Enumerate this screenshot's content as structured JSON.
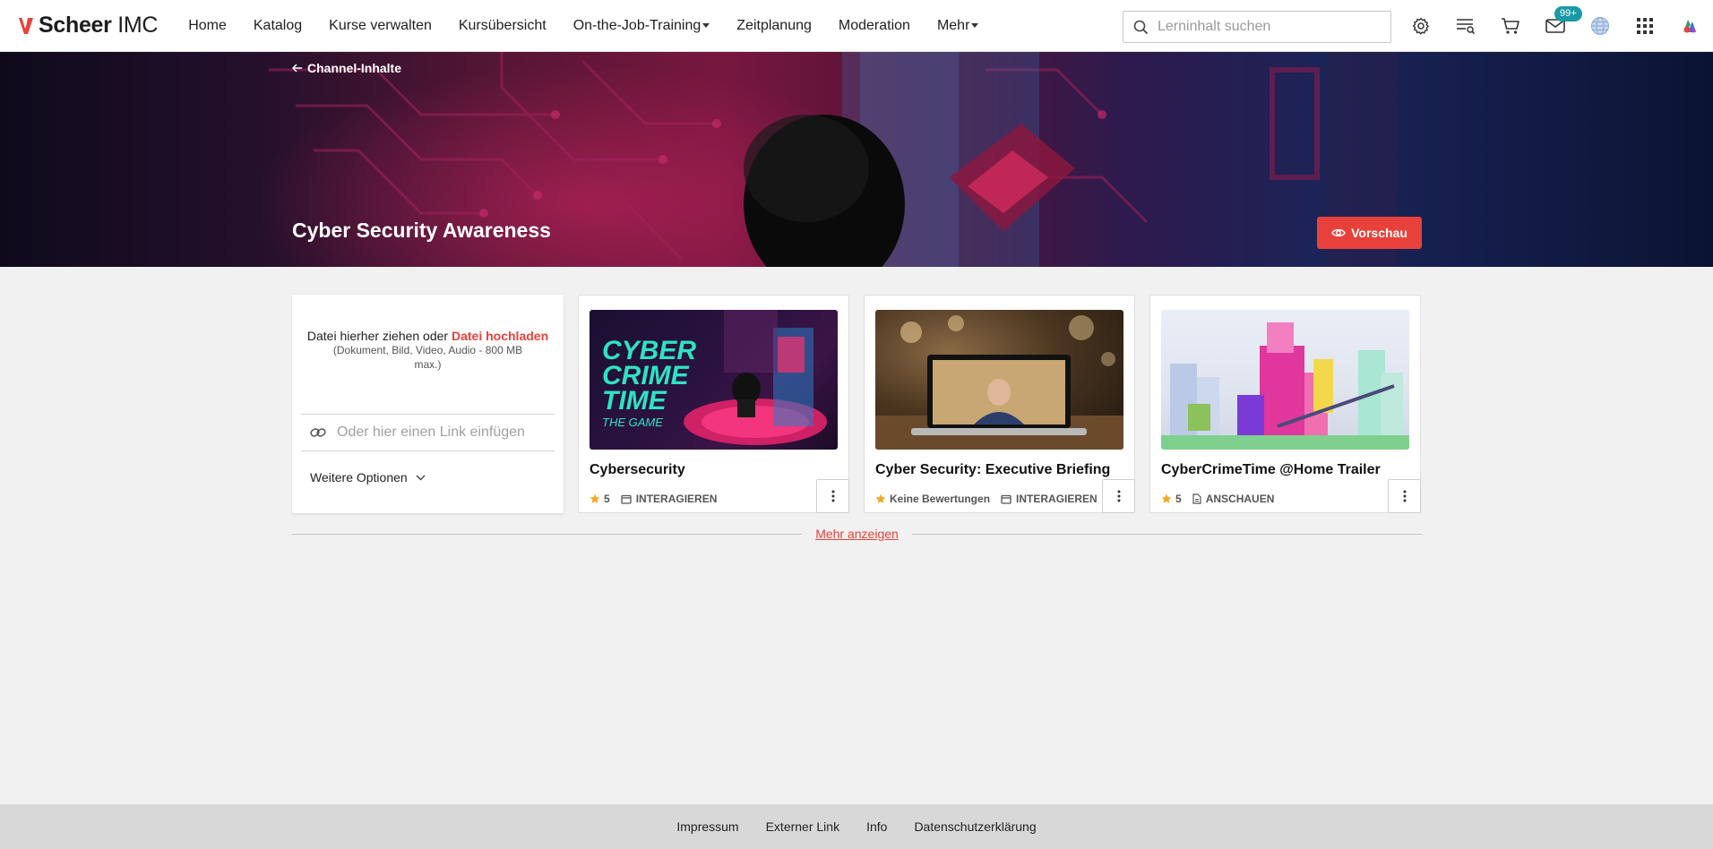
{
  "app": {
    "logo_brand": "Scheer",
    "logo_suffix": "IMC"
  },
  "nav": {
    "items": [
      {
        "label": "Home"
      },
      {
        "label": "Katalog"
      },
      {
        "label": "Kurse verwalten"
      },
      {
        "label": "Kursübersicht"
      },
      {
        "label": "On-the-Job-Training",
        "dropdown": true
      },
      {
        "label": "Zeitplanung"
      },
      {
        "label": "Moderation"
      },
      {
        "label": "Mehr",
        "dropdown": true
      }
    ],
    "search_placeholder": "Lerninhalt suchen",
    "messages_badge": "99+",
    "icons": [
      "search-icon",
      "gear-icon",
      "learning-list-icon",
      "cart-icon",
      "mail-icon",
      "globe-icon",
      "apps-grid-icon",
      "user-avatar-icon"
    ]
  },
  "hero": {
    "back_label": "Channel-Inhalte",
    "title": "Cyber Security Awareness",
    "preview_label": "Vorschau"
  },
  "upload": {
    "drop_text": "Datei hierher ziehen oder",
    "upload_link": "Datei hochladen",
    "hint": "(Dokument, Bild, Video, Audio - 800 MB max.)",
    "link_placeholder": "Oder hier einen Link einfügen",
    "more_options": "Weitere Optionen"
  },
  "cards": [
    {
      "title": "Cybersecurity",
      "rating": "5",
      "type": "INTERAGIEREN",
      "thumb_text": [
        "CYBER",
        "CRIME",
        "TIME"
      ],
      "thumb_sub": "THE GAME"
    },
    {
      "title": "Cyber Security: Executive Briefing",
      "rating": "Keine Bewertungen",
      "type": "INTERAGIEREN"
    },
    {
      "title": "CyberCrimeTime @Home Trailer",
      "rating": "5",
      "type": "ANSCHAUEN"
    }
  ],
  "show_more": "Mehr anzeigen",
  "footer": {
    "links": [
      "Impressum",
      "Externer Link",
      "Info",
      "Datenschutzerklärung"
    ]
  },
  "colors": {
    "accent": "#e8413b",
    "badge": "#1a9aa6",
    "star": "#f5a623"
  }
}
